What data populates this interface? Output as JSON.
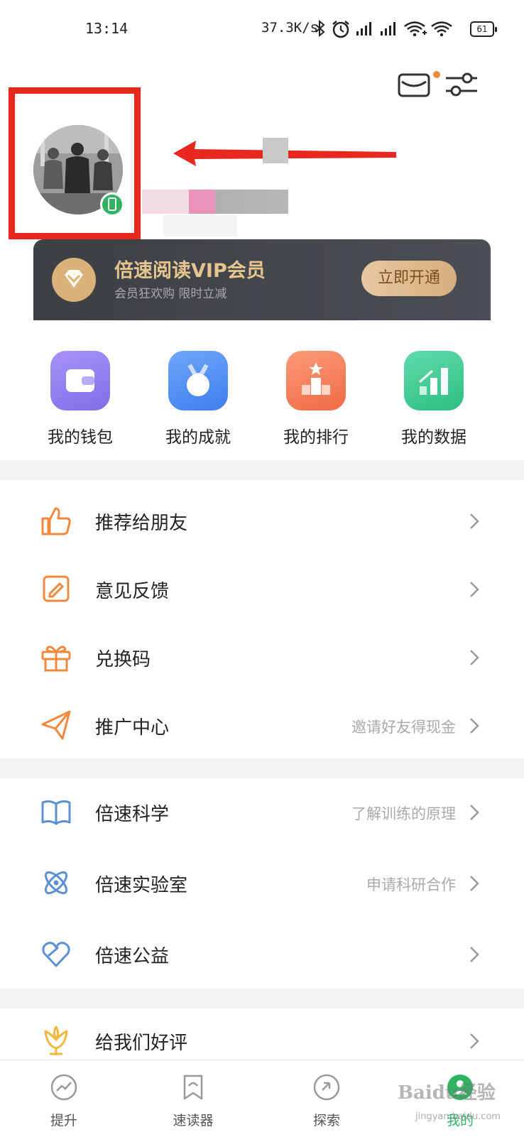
{
  "status_bar": {
    "time": "13:14",
    "net_speed": "37.3K/s",
    "battery": "61"
  },
  "vip": {
    "title": "倍速阅读VIP会员",
    "subtitle": "会员狂欢购 限时立减",
    "button": "立即开通"
  },
  "quick_actions": [
    {
      "label": "我的钱包",
      "icon": "wallet-icon",
      "color": "#8a7cf0"
    },
    {
      "label": "我的成就",
      "icon": "medal-icon",
      "color": "#4f8ef5"
    },
    {
      "label": "我的排行",
      "icon": "podium-icon",
      "color": "#f5764f"
    },
    {
      "label": "我的数据",
      "icon": "chart-icon",
      "color": "#3fcf97"
    }
  ],
  "menu_group1": [
    {
      "label": "推荐给朋友",
      "hint": "",
      "icon": "thumbs-up-icon"
    },
    {
      "label": "意见反馈",
      "hint": "",
      "icon": "edit-note-icon"
    },
    {
      "label": "兑换码",
      "hint": "",
      "icon": "gift-icon"
    },
    {
      "label": "推广中心",
      "hint": "邀请好友得现金",
      "icon": "paper-plane-icon"
    }
  ],
  "menu_group2": [
    {
      "label": "倍速科学",
      "hint": "了解训练的原理",
      "icon": "book-icon"
    },
    {
      "label": "倍速实验室",
      "hint": "申请科研合作",
      "icon": "atom-icon"
    },
    {
      "label": "倍速公益",
      "hint": "",
      "icon": "heart-icon"
    }
  ],
  "menu_group3": [
    {
      "label": "给我们好评",
      "hint": "",
      "icon": "flower-icon"
    }
  ],
  "bottom_nav": [
    {
      "label": "提升",
      "icon": "trend-icon"
    },
    {
      "label": "速读器",
      "icon": "bookmark-icon"
    },
    {
      "label": "探索",
      "icon": "compass-icon"
    },
    {
      "label": "我的",
      "icon": "profile-icon",
      "active": true
    }
  ],
  "watermark": {
    "text": "Baidu经验",
    "url_text": "jingyan.baidu.com"
  },
  "colors": {
    "accent_orange": "#f0883e",
    "accent_blue": "#5b8fd6",
    "active_green": "#30b464",
    "vip_gold": "#e6c48e",
    "highlight_red": "#e8281f"
  }
}
